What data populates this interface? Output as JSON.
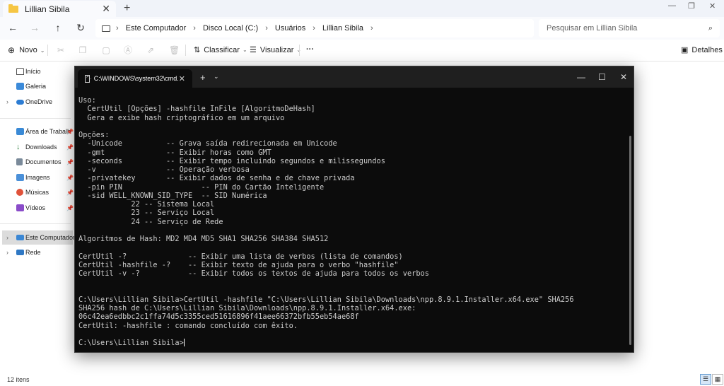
{
  "explorer": {
    "tab_title": "Lillian Sibila",
    "breadcrumb": [
      "Este Computador",
      "Disco Local (C:)",
      "Usuários",
      "Lillian Sibila"
    ],
    "search_placeholder": "Pesquisar em Lillian Sibila",
    "commands": {
      "new": "Novo",
      "sort": "Classificar",
      "view": "Visualizar",
      "more": "···",
      "details": "Detalhes"
    },
    "nav": {
      "home": "Início",
      "gallery": "Galeria",
      "onedrive": "OneDrive",
      "desktop": "Área de Trabalh",
      "downloads": "Downloads",
      "documents": "Documentos",
      "pictures": "Imagens",
      "music": "Músicas",
      "videos": "Vídeos",
      "this_pc": "Este Computador",
      "network": "Rede"
    },
    "status_text": "12 itens"
  },
  "terminal": {
    "tab_title": "C:\\WINDOWS\\system32\\cmd.",
    "lines": [
      "Uso:",
      "  CertUtil [Opções] -hashfile InFile [AlgoritmoDeHash]",
      "  Gera e exibe hash criptográfico em um arquivo",
      "",
      "Opções:",
      "  -Unicode          -- Grava saída redirecionada em Unicode",
      "  -gmt              -- Exibir horas como GMT",
      "  -seconds          -- Exibir tempo incluindo segundos e milissegundos",
      "  -v                -- Operação verbosa",
      "  -privatekey       -- Exibir dados de senha e de chave privada",
      "  -pin PIN                  -- PIN do Cartão Inteligente",
      "  -sid WELL_KNOWN_SID_TYPE  -- SID Numérica",
      "            22 -- Sistema Local",
      "            23 -- Serviço Local",
      "            24 -- Serviço de Rede",
      "",
      "Algoritmos de Hash: MD2 MD4 MD5 SHA1 SHA256 SHA384 SHA512",
      "",
      "CertUtil -?              -- Exibir uma lista de verbos (lista de comandos)",
      "CertUtil -hashfile -?    -- Exibir texto de ajuda para o verbo \"hashfile\"",
      "CertUtil -v -?           -- Exibir todos os textos de ajuda para todos os verbos",
      "",
      "",
      "C:\\Users\\Lillian Sibila>CertUtil -hashfile \"C:\\Users\\Lillian Sibila\\Downloads\\npp.8.9.1.Installer.x64.exe\" SHA256",
      "SHA256 hash de C:\\Users\\Lillian Sibila\\Downloads\\npp.8.9.1.Installer.x64.exe:",
      "06c42ea6edbbc2c1ffa74d5c3355ced51616896f41aee66372bfb55eb54ae68f",
      "CertUtil: -hashfile : comando concluído com êxito.",
      ""
    ],
    "prompt": "C:\\Users\\Lillian Sibila>"
  },
  "colors": {
    "terminal_bg": "#0c0c0c",
    "terminal_text": "#cccccc",
    "folder": "#f6c644"
  }
}
